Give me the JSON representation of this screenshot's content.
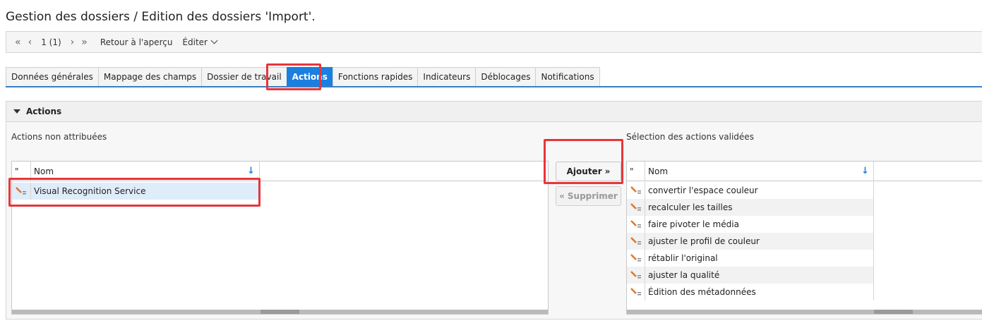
{
  "title": "Gestion des dossiers / Edition des dossiers 'Import'.",
  "toolbar": {
    "first_icon": "double-chevron-left-icon",
    "prev_icon": "chevron-left-icon",
    "page_text": "1 (1)",
    "next_icon": "chevron-right-icon",
    "last_icon": "double-chevron-right-icon",
    "back_label": "Retour à l'aperçu",
    "edit_label": "Éditer"
  },
  "tabs": [
    {
      "label": "Données générales"
    },
    {
      "label": "Mappage des champs"
    },
    {
      "label": "Dossier de travail"
    },
    {
      "label": "Actions"
    },
    {
      "label": "Fonctions rapides"
    },
    {
      "label": "Indicateurs"
    },
    {
      "label": "Déblocages"
    },
    {
      "label": "Notifications"
    }
  ],
  "active_tab": "Actions",
  "section": {
    "title": "Actions",
    "left_label": "Actions non attribuées",
    "right_label": "Sélection des actions validées",
    "col_icon": "\"",
    "col_name": "Nom",
    "left_rows": [
      "Visual Recognition Service"
    ],
    "right_rows": [
      "convertir l'espace couleur",
      "recalculer les tailles",
      "faire pivoter le média",
      "ajuster le profil de couleur",
      "rétablir l'original",
      "ajuster la qualité",
      "Édition des métadonnées"
    ],
    "add_label": "Ajouter",
    "remove_label": "Supprimer"
  },
  "colors": {
    "accent": "#1a7fe0",
    "highlight": "#e6363b",
    "selected_row": "#dfecf9"
  }
}
